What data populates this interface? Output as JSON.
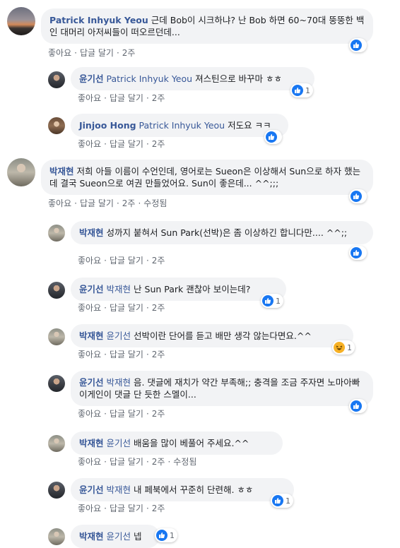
{
  "action_labels": {
    "like": "좋아요",
    "reply": "답글 달기",
    "edited": "수정됨"
  },
  "comments": [
    {
      "author": "Patrick Inhyuk Yeou",
      "mention": "",
      "text": "근데 Bob이 시크하냐? 난 Bob 하면 60~70대 뚱뚱한 백인 대머리 아저씨들이 떠오르던데...",
      "time": "2주",
      "edited": false,
      "reaction": {
        "type": "like",
        "count": ""
      }
    },
    {
      "author": "윤기선",
      "mention": "Patrick Inhyuk Yeou",
      "text": "져스틴으로 바꾸마 ㅎㅎ",
      "time": "2주",
      "edited": false,
      "reaction": {
        "type": "like",
        "count": "1"
      }
    },
    {
      "author": "Jinjoo Hong",
      "mention": "Patrick Inhyuk Yeou",
      "text": "저도요 ㅋㅋ",
      "time": "2주",
      "edited": false,
      "reaction": {
        "type": "like",
        "count": ""
      }
    },
    {
      "author": "박재현",
      "mention": "",
      "text": "저희 아들 이름이 수언인데, 영어로는 Sueon은 이상해서 Sun으로 하자 했는데 결국 Sueon으로 여권 만들었어요. Sun이 좋은데... ^^;;;",
      "time": "2주",
      "edited": true,
      "reaction": {
        "type": "like",
        "count": ""
      }
    },
    {
      "author": "박재현",
      "mention": "",
      "text": "성까지 붙혀서 Sun Park(선박)은 좀 이상하긴 합니다만.... ^^;;",
      "time": "2주",
      "edited": false,
      "reaction": {
        "type": "like",
        "count": ""
      }
    },
    {
      "author": "윤기선",
      "mention": "박재현",
      "text": "난 Sun Park 괜찮아 보이는데?",
      "time": "2주",
      "edited": false,
      "reaction": {
        "type": "like",
        "count": "1"
      }
    },
    {
      "author": "박재현",
      "mention": "윤기선",
      "text": "선박이란 단어를 듣고 배만 생각 않는다면요.^^",
      "time": "2주",
      "edited": false,
      "reaction": {
        "type": "haha",
        "count": "1"
      }
    },
    {
      "author": "윤기선",
      "mention": "박재현",
      "text": "음. 댓글에 재치가 약간 부족해;; 충격을 조금 주자면 노마아빠 이게인이 댓글 단 듯한 스멜이...",
      "time": "2주",
      "edited": false,
      "reaction": {
        "type": "like",
        "count": ""
      }
    },
    {
      "author": "박재현",
      "mention": "윤기선",
      "text": "배움을 많이 베풀어 주세요.^^",
      "time": "2주",
      "edited": true,
      "reaction": {
        "type": "like",
        "count": ""
      }
    },
    {
      "author": "윤기선",
      "mention": "박재현",
      "text": "내 페북에서 꾸준히 단련해. ㅎㅎ",
      "time": "2주",
      "edited": false,
      "reaction": {
        "type": "like",
        "count": "1"
      }
    },
    {
      "author": "박재현",
      "mention": "윤기선",
      "text": "넵",
      "time": "",
      "edited": false,
      "reaction": {
        "type": "like",
        "count": "1"
      }
    }
  ]
}
